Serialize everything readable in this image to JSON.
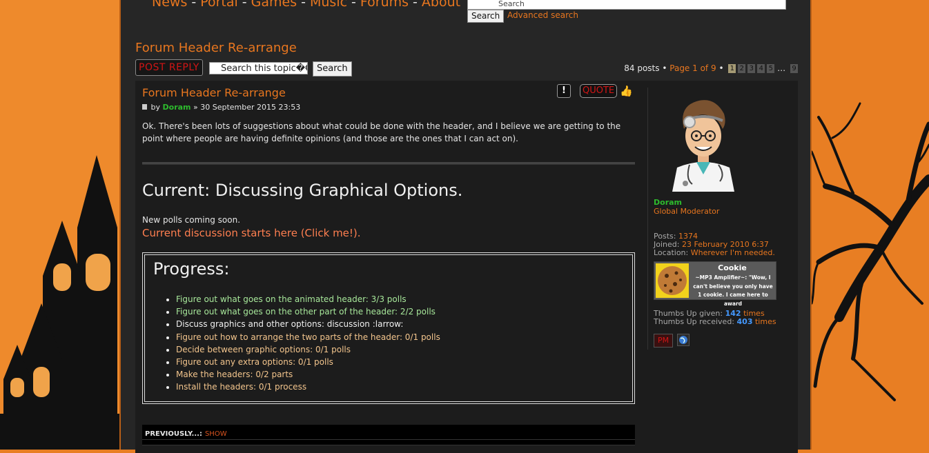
{
  "nav": {
    "items": [
      "News",
      "Portal",
      "Games",
      "Music",
      "Forums",
      "About"
    ],
    "separator": "-"
  },
  "site_search": {
    "placeholder": "Search",
    "button": "Search",
    "advanced": "Advanced search"
  },
  "topic": {
    "title": "Forum Header Re-arrange",
    "post_reply": "POST REPLY",
    "search_placeholder": "Search this topic�€",
    "search_button": "Search"
  },
  "pagination": {
    "posts_count": "84 posts",
    "bullet": "•",
    "page_label": "Page 1 of 9",
    "pages": [
      "1",
      "2",
      "3",
      "4",
      "5"
    ],
    "ellipsis": "…",
    "last": "9"
  },
  "post": {
    "title": "Forum Header Re-arrange",
    "report_label": "!",
    "quote_label": "QUOTE",
    "by": "by",
    "author": "Doram",
    "date": "» 30 September 2015 23:53",
    "body": "Ok. There's been lots of suggestions about what could be done with the header, and I believe we are getting to the point where people are having definite opinions (and those are the ones that I can act on).",
    "current_heading": "Current: Discussing Graphical Options.",
    "new_polls": "New polls coming soon.",
    "discussion_link": "Current discussion starts here (Click me!).",
    "progress_heading": "Progress:",
    "progress_items": [
      {
        "text": "Figure out what goes on the animated header: 3/3 polls",
        "state": "done"
      },
      {
        "text": "Figure out what goes on the other part of the header: 2/2 polls",
        "state": "done"
      },
      {
        "text": "Discuss graphics and other options: discussion :larrow:",
        "state": "current"
      },
      {
        "text": "Figure out how to arrange the two parts of the header: 0/1 polls",
        "state": "todo"
      },
      {
        "text": "Decide between graphic options: 0/1 polls",
        "state": "todo"
      },
      {
        "text": "Figure out any extra options: 0/1 polls",
        "state": "todo"
      },
      {
        "text": "Make the headers: 0/2 parts",
        "state": "todo"
      },
      {
        "text": "Install the headers: 0/1 process",
        "state": "todo"
      }
    ],
    "previously_label": "PREVIOUSLY...:",
    "previously_show": "SHOW"
  },
  "profile": {
    "name": "Doram",
    "rank": "Global Moderator",
    "posts_label": "Posts:",
    "posts_value": "1374",
    "joined_label": "Joined:",
    "joined_value": "23 February 2010 6:37",
    "location_label": "Location:",
    "location_value": "Wherever I'm needed.",
    "cookie_title": "Cookie",
    "cookie_desc": "~MP3 Amplifier~: \"Wow, I can't believe you only have 1 cookie. I came here to award",
    "thumbs_given_label": "Thumbs Up given:",
    "thumbs_given_value": "142",
    "thumbs_received_label": "Thumbs Up received:",
    "thumbs_received_value": "403",
    "times": "times",
    "pm_label": "PM"
  },
  "colors": {
    "accent": "#e8761f",
    "background": "#e87e23",
    "panel": "#262626",
    "author_green": "#2dbb2d",
    "link_blue": "#4499ff"
  }
}
